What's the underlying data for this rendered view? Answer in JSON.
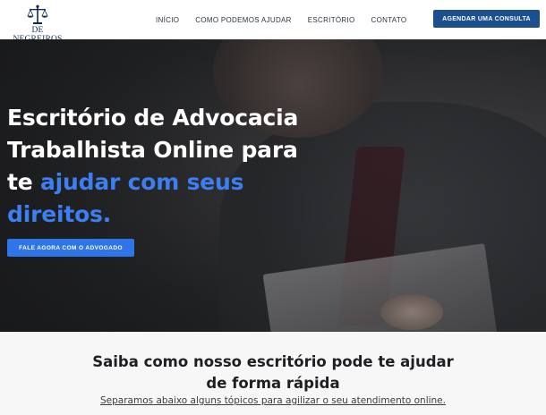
{
  "brand": {
    "name": "DE NEGREIROS",
    "logo_icon": "scales-of-justice-icon",
    "primary_color": "#0f2a4d"
  },
  "nav": {
    "items": [
      {
        "label": "INÍCIO"
      },
      {
        "label": "COMO PODEMOS AJUDAR"
      },
      {
        "label": "ESCRITÓRIO"
      },
      {
        "label": "CONTATO"
      }
    ],
    "cta_label": "AGENDAR UMA CONSULTA",
    "cta_color": "#1b4f8f"
  },
  "hero": {
    "title_line1": "Escritório de Advocacia",
    "title_line2": "Trabalhista Online para",
    "title_line3_plain": "te ",
    "title_line3_accent": "ajudar com seus",
    "title_line4_accent": "direitos.",
    "accent_color": "#3d7ef0",
    "button_label": "FALE AGORA COM O ADVOGADO",
    "button_color": "#2f74e8"
  },
  "section": {
    "title_line1": "Saiba como nosso escritório pode te ajudar",
    "title_line2": "de forma rápida",
    "subtitle": "Separamos abaixo alguns tópicos para agilizar o seu atendimento online."
  }
}
